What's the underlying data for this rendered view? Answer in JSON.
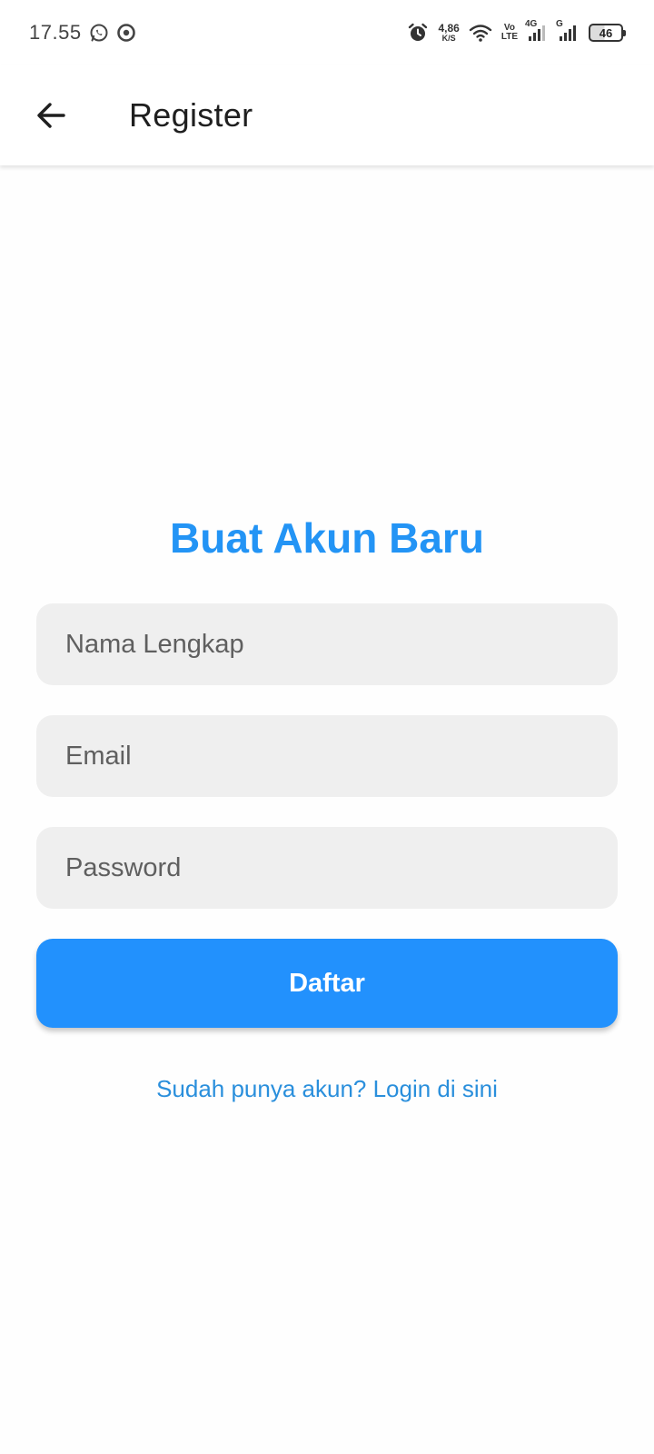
{
  "status_bar": {
    "time": "17.55",
    "net_speed_value": "4,86",
    "net_speed_unit": "K/S",
    "volte_top": "Vo",
    "volte_bottom": "LTE",
    "sim1_tag": "4G",
    "sim2_tag": "G",
    "battery_level": "46",
    "icons": [
      "whatsapp-icon",
      "app-notification-icon",
      "alarm-icon",
      "wifi-icon",
      "signal-icon",
      "battery-icon"
    ]
  },
  "app_bar": {
    "title": "Register",
    "back_icon": "arrow-left-icon"
  },
  "form": {
    "heading": "Buat Akun Baru",
    "name_placeholder": "Nama Lengkap",
    "email_placeholder": "Email",
    "password_placeholder": "Password",
    "submit_label": "Daftar",
    "login_link": "Sudah punya akun? Login di sini"
  },
  "colors": {
    "accent": "#2291fd",
    "heading": "#2394f5",
    "link": "#2a8fdc",
    "field_bg": "#efefef"
  }
}
